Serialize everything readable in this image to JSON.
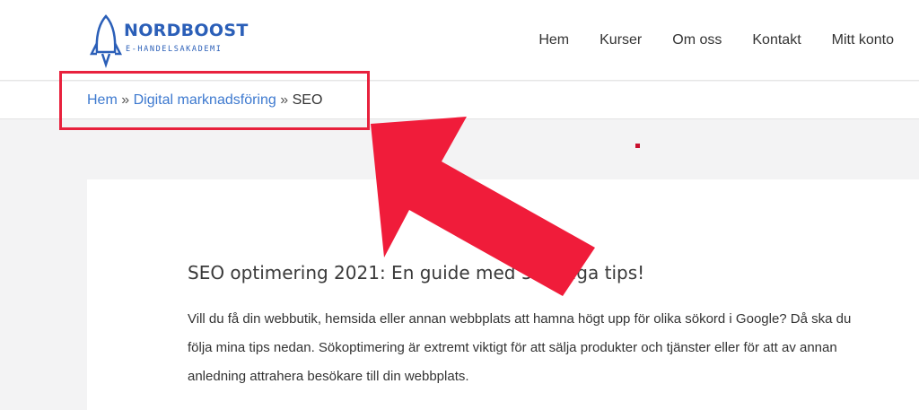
{
  "brand": {
    "name": "NORDBOOST",
    "tagline": "E-HANDELSAKADEMI",
    "color": "#2b5fb8"
  },
  "nav": {
    "items": [
      "Hem",
      "Kurser",
      "Om oss",
      "Kontakt",
      "Mitt konto"
    ]
  },
  "breadcrumb": {
    "home": "Hem",
    "separator": "»",
    "parent": "Digital marknadsföring",
    "current": "SEO",
    "link_color": "#3d79cf"
  },
  "annotation": {
    "color": "#e8213d"
  },
  "article": {
    "title": "SEO optimering 2021: En guide med 5 viktiga tips!",
    "intro": "Vill du få din webbutik, hemsida eller annan webbplats att hamna högt upp för olika sökord i Google? Då ska du följa mina tips nedan. Sökoptimering är extremt viktigt för att sälja produkter och tjänster eller för att av annan anledning attrahera besökare till din webbplats."
  }
}
